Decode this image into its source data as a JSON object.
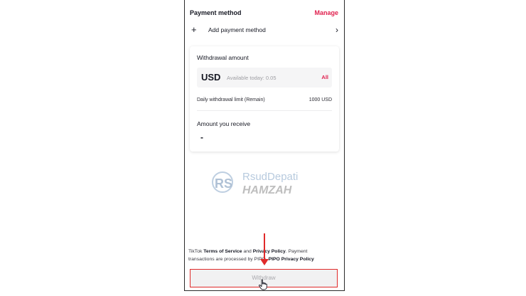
{
  "payment_method": {
    "title": "Payment method",
    "manage_label": "Manage",
    "add_icon": "plus-icon",
    "add_label": "Add payment method",
    "chevron_icon": "chevron-right-icon"
  },
  "withdrawal": {
    "title": "Withdrawal amount",
    "currency": "USD",
    "placeholder": "Available today: 0.05",
    "all_label": "All",
    "limit_label": "Daily withdrawal limit (Remain)",
    "limit_value": "1000 USD",
    "receive_label": "Amount you receive",
    "receive_value": "-"
  },
  "watermark": {
    "logo_text": "RS",
    "line1": "RsudDepati",
    "line2": "HAMZAH"
  },
  "legal": {
    "p1": "TikTok ",
    "terms": "Terms of Service",
    "p2": " and ",
    "privacy": "Privacy Policy",
    "p3": ". Payment transactions are processed by PIPO. ",
    "pipo": "PIPO Privacy Policy"
  },
  "withdraw_button": {
    "label": "Withdraw"
  },
  "annotation": {
    "color": "#e02a2a",
    "cursor_icon": "hand-pointer-icon"
  },
  "colors": {
    "accent": "#e0214f",
    "text": "#161823",
    "muted": "#9e9ea3"
  }
}
